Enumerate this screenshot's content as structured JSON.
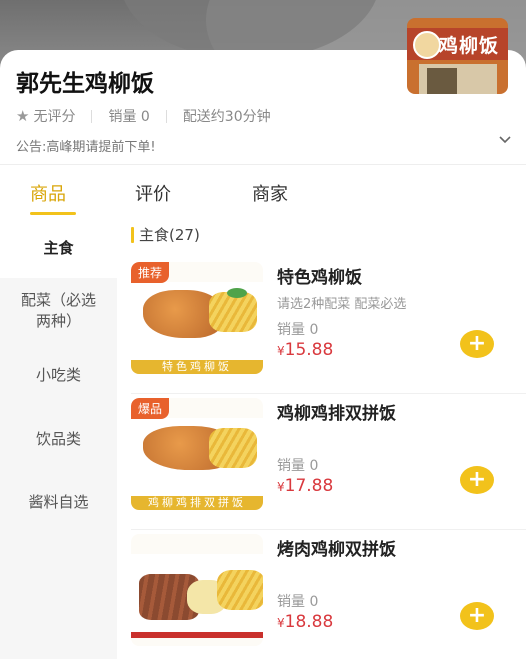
{
  "shop": {
    "name": "郭先生鸡柳饭",
    "thumb_sign": "鸡柳饭",
    "rating": "无评分",
    "sales": "销量 0",
    "delivery": "配送约30分钟",
    "notice": "公告:高峰期请提前下单!"
  },
  "tabs": [
    {
      "label": "商品",
      "active": true
    },
    {
      "label": "评价",
      "active": false
    },
    {
      "label": "商家",
      "active": false
    }
  ],
  "categories": [
    {
      "label": "主食",
      "active": true
    },
    {
      "label": "配菜（必选两种）",
      "active": false
    },
    {
      "label": "小吃类",
      "active": false
    },
    {
      "label": "饮品类",
      "active": false
    },
    {
      "label": "酱料自选",
      "active": false
    }
  ],
  "section": {
    "title": "主食(27)"
  },
  "items": [
    {
      "name": "特色鸡柳饭",
      "desc": "请选2种配菜 配菜必选",
      "sales": "销量 0",
      "currency": "¥",
      "price": "15.88",
      "tag": "推荐",
      "strip": "特色鸡柳饭"
    },
    {
      "name": "鸡柳鸡排双拼饭",
      "desc": "",
      "sales": "销量 0",
      "currency": "¥",
      "price": "17.88",
      "tag": "爆品",
      "strip": "鸡柳鸡排双拼饭"
    },
    {
      "name": "烤肉鸡柳双拼饭",
      "desc": "",
      "sales": "销量 0",
      "currency": "¥",
      "price": "18.88",
      "tag": "",
      "strip": ""
    }
  ],
  "colors": {
    "accent": "#f2c21b",
    "accent_text": "#d9a60a",
    "price": "#d9393e",
    "tag": "#e8612c"
  },
  "icons": {
    "rating": "star-icon",
    "expand": "chevron-down-icon",
    "add": "plus-icon"
  },
  "add_symbol": "+"
}
